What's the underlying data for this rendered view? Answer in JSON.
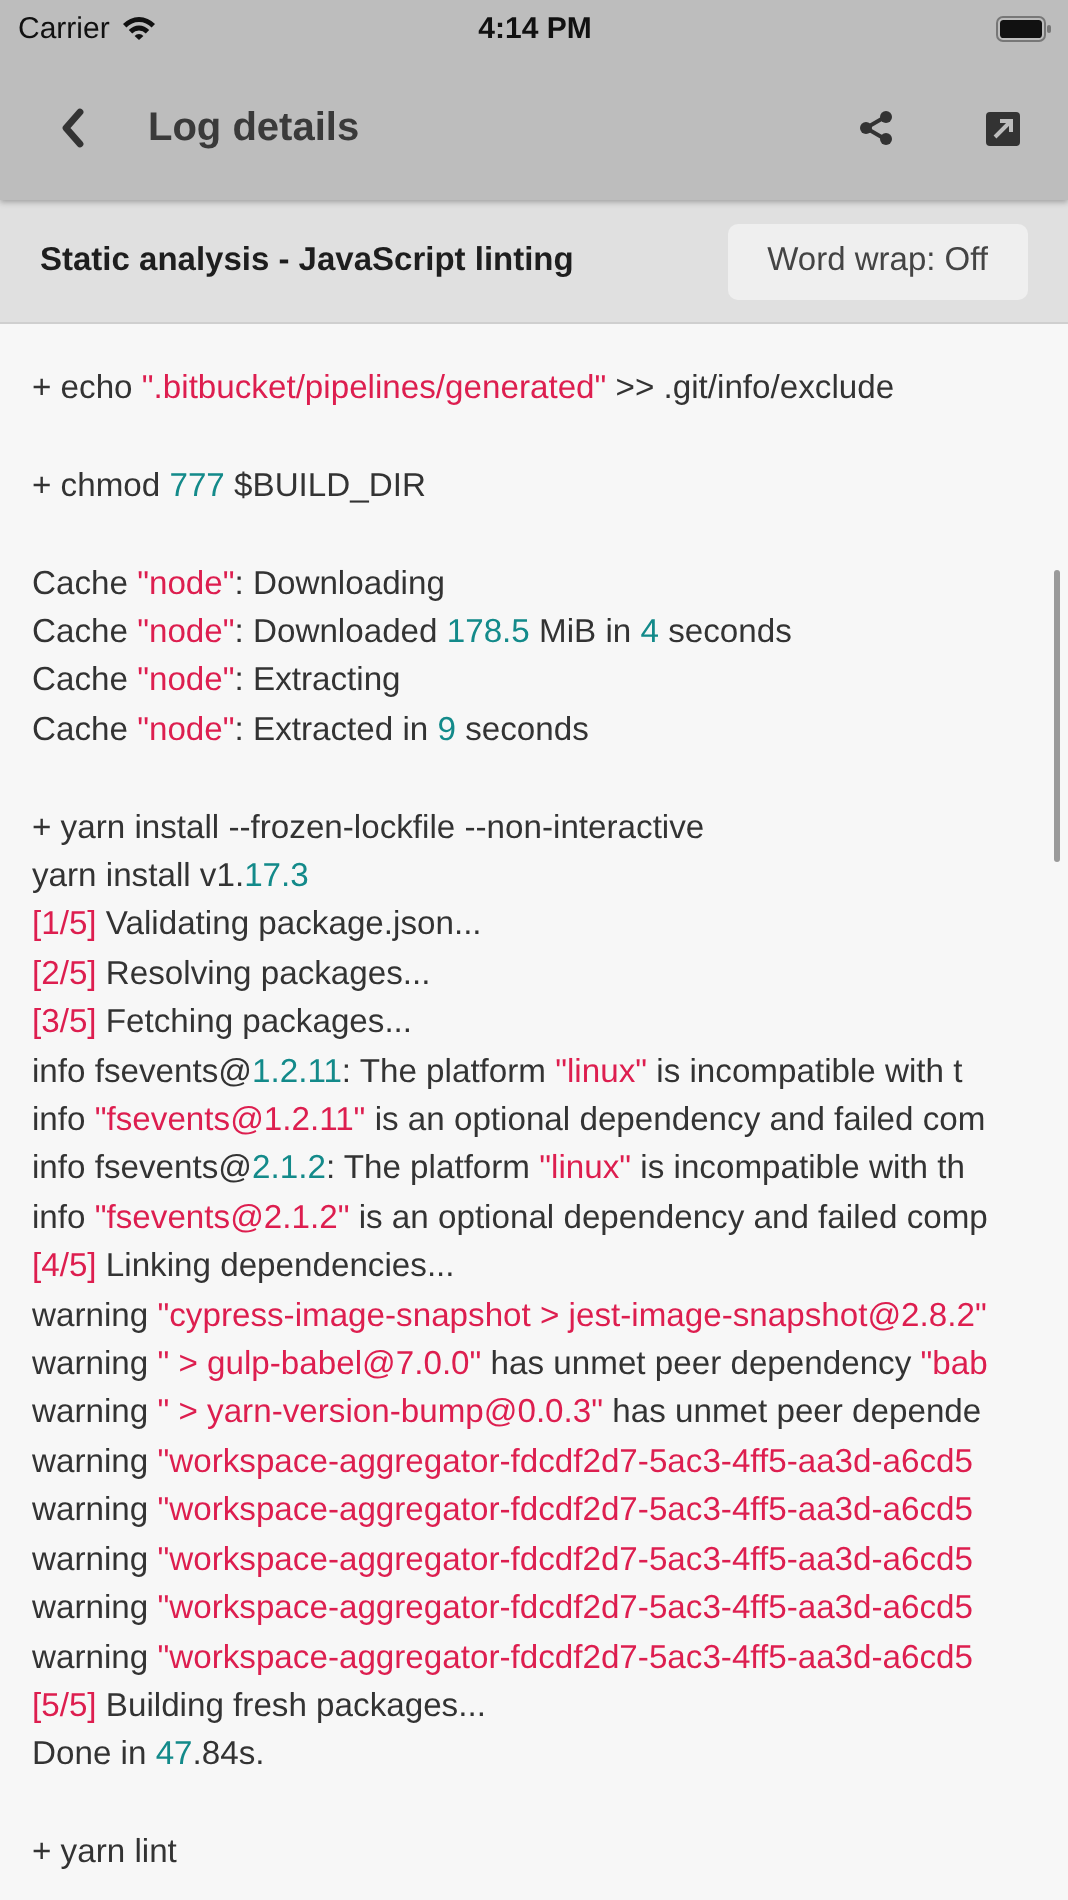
{
  "status_bar": {
    "carrier": "Carrier",
    "time": "4:14 PM"
  },
  "nav_bar": {
    "title": "Log details"
  },
  "step": {
    "title": "Static analysis - JavaScript linting",
    "word_wrap_button": "Word wrap: Off"
  },
  "log_blocks": [
    [
      [
        {
          "kind": "plain",
          "text": "+ echo "
        },
        {
          "kind": "string",
          "text": "\".bitbucket/pipelines/generated\""
        },
        {
          "kind": "plain",
          "text": " >> .git/info/exclude"
        }
      ]
    ],
    [
      [
        {
          "kind": "plain",
          "text": "+ chmod "
        },
        {
          "kind": "number",
          "text": "777"
        },
        {
          "kind": "plain",
          "text": " $BUILD_DIR"
        }
      ]
    ],
    [
      [
        {
          "kind": "plain",
          "text": "Cache "
        },
        {
          "kind": "string",
          "text": "\"node\""
        },
        {
          "kind": "plain",
          "text": ": Downloading"
        }
      ],
      [
        {
          "kind": "plain",
          "text": "Cache "
        },
        {
          "kind": "string",
          "text": "\"node\""
        },
        {
          "kind": "plain",
          "text": ": Downloaded "
        },
        {
          "kind": "number",
          "text": "178.5"
        },
        {
          "kind": "plain",
          "text": " MiB in "
        },
        {
          "kind": "number",
          "text": "4"
        },
        {
          "kind": "plain",
          "text": " seconds"
        }
      ],
      [
        {
          "kind": "plain",
          "text": "Cache "
        },
        {
          "kind": "string",
          "text": "\"node\""
        },
        {
          "kind": "plain",
          "text": ": Extracting"
        }
      ],
      [
        {
          "kind": "plain",
          "text": "Cache "
        },
        {
          "kind": "string",
          "text": "\"node\""
        },
        {
          "kind": "plain",
          "text": ": Extracted in "
        },
        {
          "kind": "number",
          "text": "9"
        },
        {
          "kind": "plain",
          "text": " seconds"
        }
      ]
    ],
    [
      [
        {
          "kind": "plain",
          "text": "+ yarn install --frozen-lockfile --non-interactive"
        }
      ],
      [
        {
          "kind": "plain",
          "text": "yarn install v1."
        },
        {
          "kind": "number",
          "text": "17.3"
        }
      ],
      [
        {
          "kind": "string",
          "text": "[1/5]"
        },
        {
          "kind": "plain",
          "text": " Validating package.json..."
        }
      ],
      [
        {
          "kind": "string",
          "text": "[2/5]"
        },
        {
          "kind": "plain",
          "text": " Resolving packages..."
        }
      ],
      [
        {
          "kind": "string",
          "text": "[3/5]"
        },
        {
          "kind": "plain",
          "text": " Fetching packages..."
        }
      ],
      [
        {
          "kind": "plain",
          "text": "info fsevents@"
        },
        {
          "kind": "number",
          "text": "1.2.11"
        },
        {
          "kind": "plain",
          "text": ": The platform "
        },
        {
          "kind": "string",
          "text": "\"linux\""
        },
        {
          "kind": "plain",
          "text": " is incompatible with t"
        }
      ],
      [
        {
          "kind": "plain",
          "text": "info "
        },
        {
          "kind": "string",
          "text": "\"fsevents@1.2.11\""
        },
        {
          "kind": "plain",
          "text": " is an optional dependency and failed com"
        }
      ],
      [
        {
          "kind": "plain",
          "text": "info fsevents@"
        },
        {
          "kind": "number",
          "text": "2.1.2"
        },
        {
          "kind": "plain",
          "text": ": The platform "
        },
        {
          "kind": "string",
          "text": "\"linux\""
        },
        {
          "kind": "plain",
          "text": " is incompatible with th"
        }
      ],
      [
        {
          "kind": "plain",
          "text": "info "
        },
        {
          "kind": "string",
          "text": "\"fsevents@2.1.2\""
        },
        {
          "kind": "plain",
          "text": " is an optional dependency and failed comp"
        }
      ],
      [
        {
          "kind": "string",
          "text": "[4/5]"
        },
        {
          "kind": "plain",
          "text": " Linking dependencies..."
        }
      ],
      [
        {
          "kind": "plain",
          "text": "warning "
        },
        {
          "kind": "string",
          "text": "\"cypress-image-snapshot > jest-image-snapshot@2.8.2\""
        }
      ],
      [
        {
          "kind": "plain",
          "text": "warning "
        },
        {
          "kind": "string",
          "text": "\" > gulp-babel@7.0.0\""
        },
        {
          "kind": "plain",
          "text": " has unmet peer dependency "
        },
        {
          "kind": "string",
          "text": "\"bab"
        }
      ],
      [
        {
          "kind": "plain",
          "text": "warning "
        },
        {
          "kind": "string",
          "text": "\" > yarn-version-bump@0.0.3\""
        },
        {
          "kind": "plain",
          "text": " has unmet peer depende"
        }
      ],
      [
        {
          "kind": "plain",
          "text": "warning "
        },
        {
          "kind": "string",
          "text": "\"workspace-aggregator-fdcdf2d7-5ac3-4ff5-aa3d-a6cd5"
        }
      ],
      [
        {
          "kind": "plain",
          "text": "warning "
        },
        {
          "kind": "string",
          "text": "\"workspace-aggregator-fdcdf2d7-5ac3-4ff5-aa3d-a6cd5"
        }
      ],
      [
        {
          "kind": "plain",
          "text": "warning "
        },
        {
          "kind": "string",
          "text": "\"workspace-aggregator-fdcdf2d7-5ac3-4ff5-aa3d-a6cd5"
        }
      ],
      [
        {
          "kind": "plain",
          "text": "warning "
        },
        {
          "kind": "string",
          "text": "\"workspace-aggregator-fdcdf2d7-5ac3-4ff5-aa3d-a6cd5"
        }
      ],
      [
        {
          "kind": "plain",
          "text": "warning "
        },
        {
          "kind": "string",
          "text": "\"workspace-aggregator-fdcdf2d7-5ac3-4ff5-aa3d-a6cd5"
        }
      ],
      [
        {
          "kind": "string",
          "text": "[5/5]"
        },
        {
          "kind": "plain",
          "text": " Building fresh packages..."
        }
      ],
      [
        {
          "kind": "plain",
          "text": "Done in "
        },
        {
          "kind": "number",
          "text": "47"
        },
        {
          "kind": "plain",
          "text": ".84s."
        }
      ]
    ],
    [
      [
        {
          "kind": "plain",
          "text": "+ yarn lint"
        }
      ]
    ]
  ]
}
